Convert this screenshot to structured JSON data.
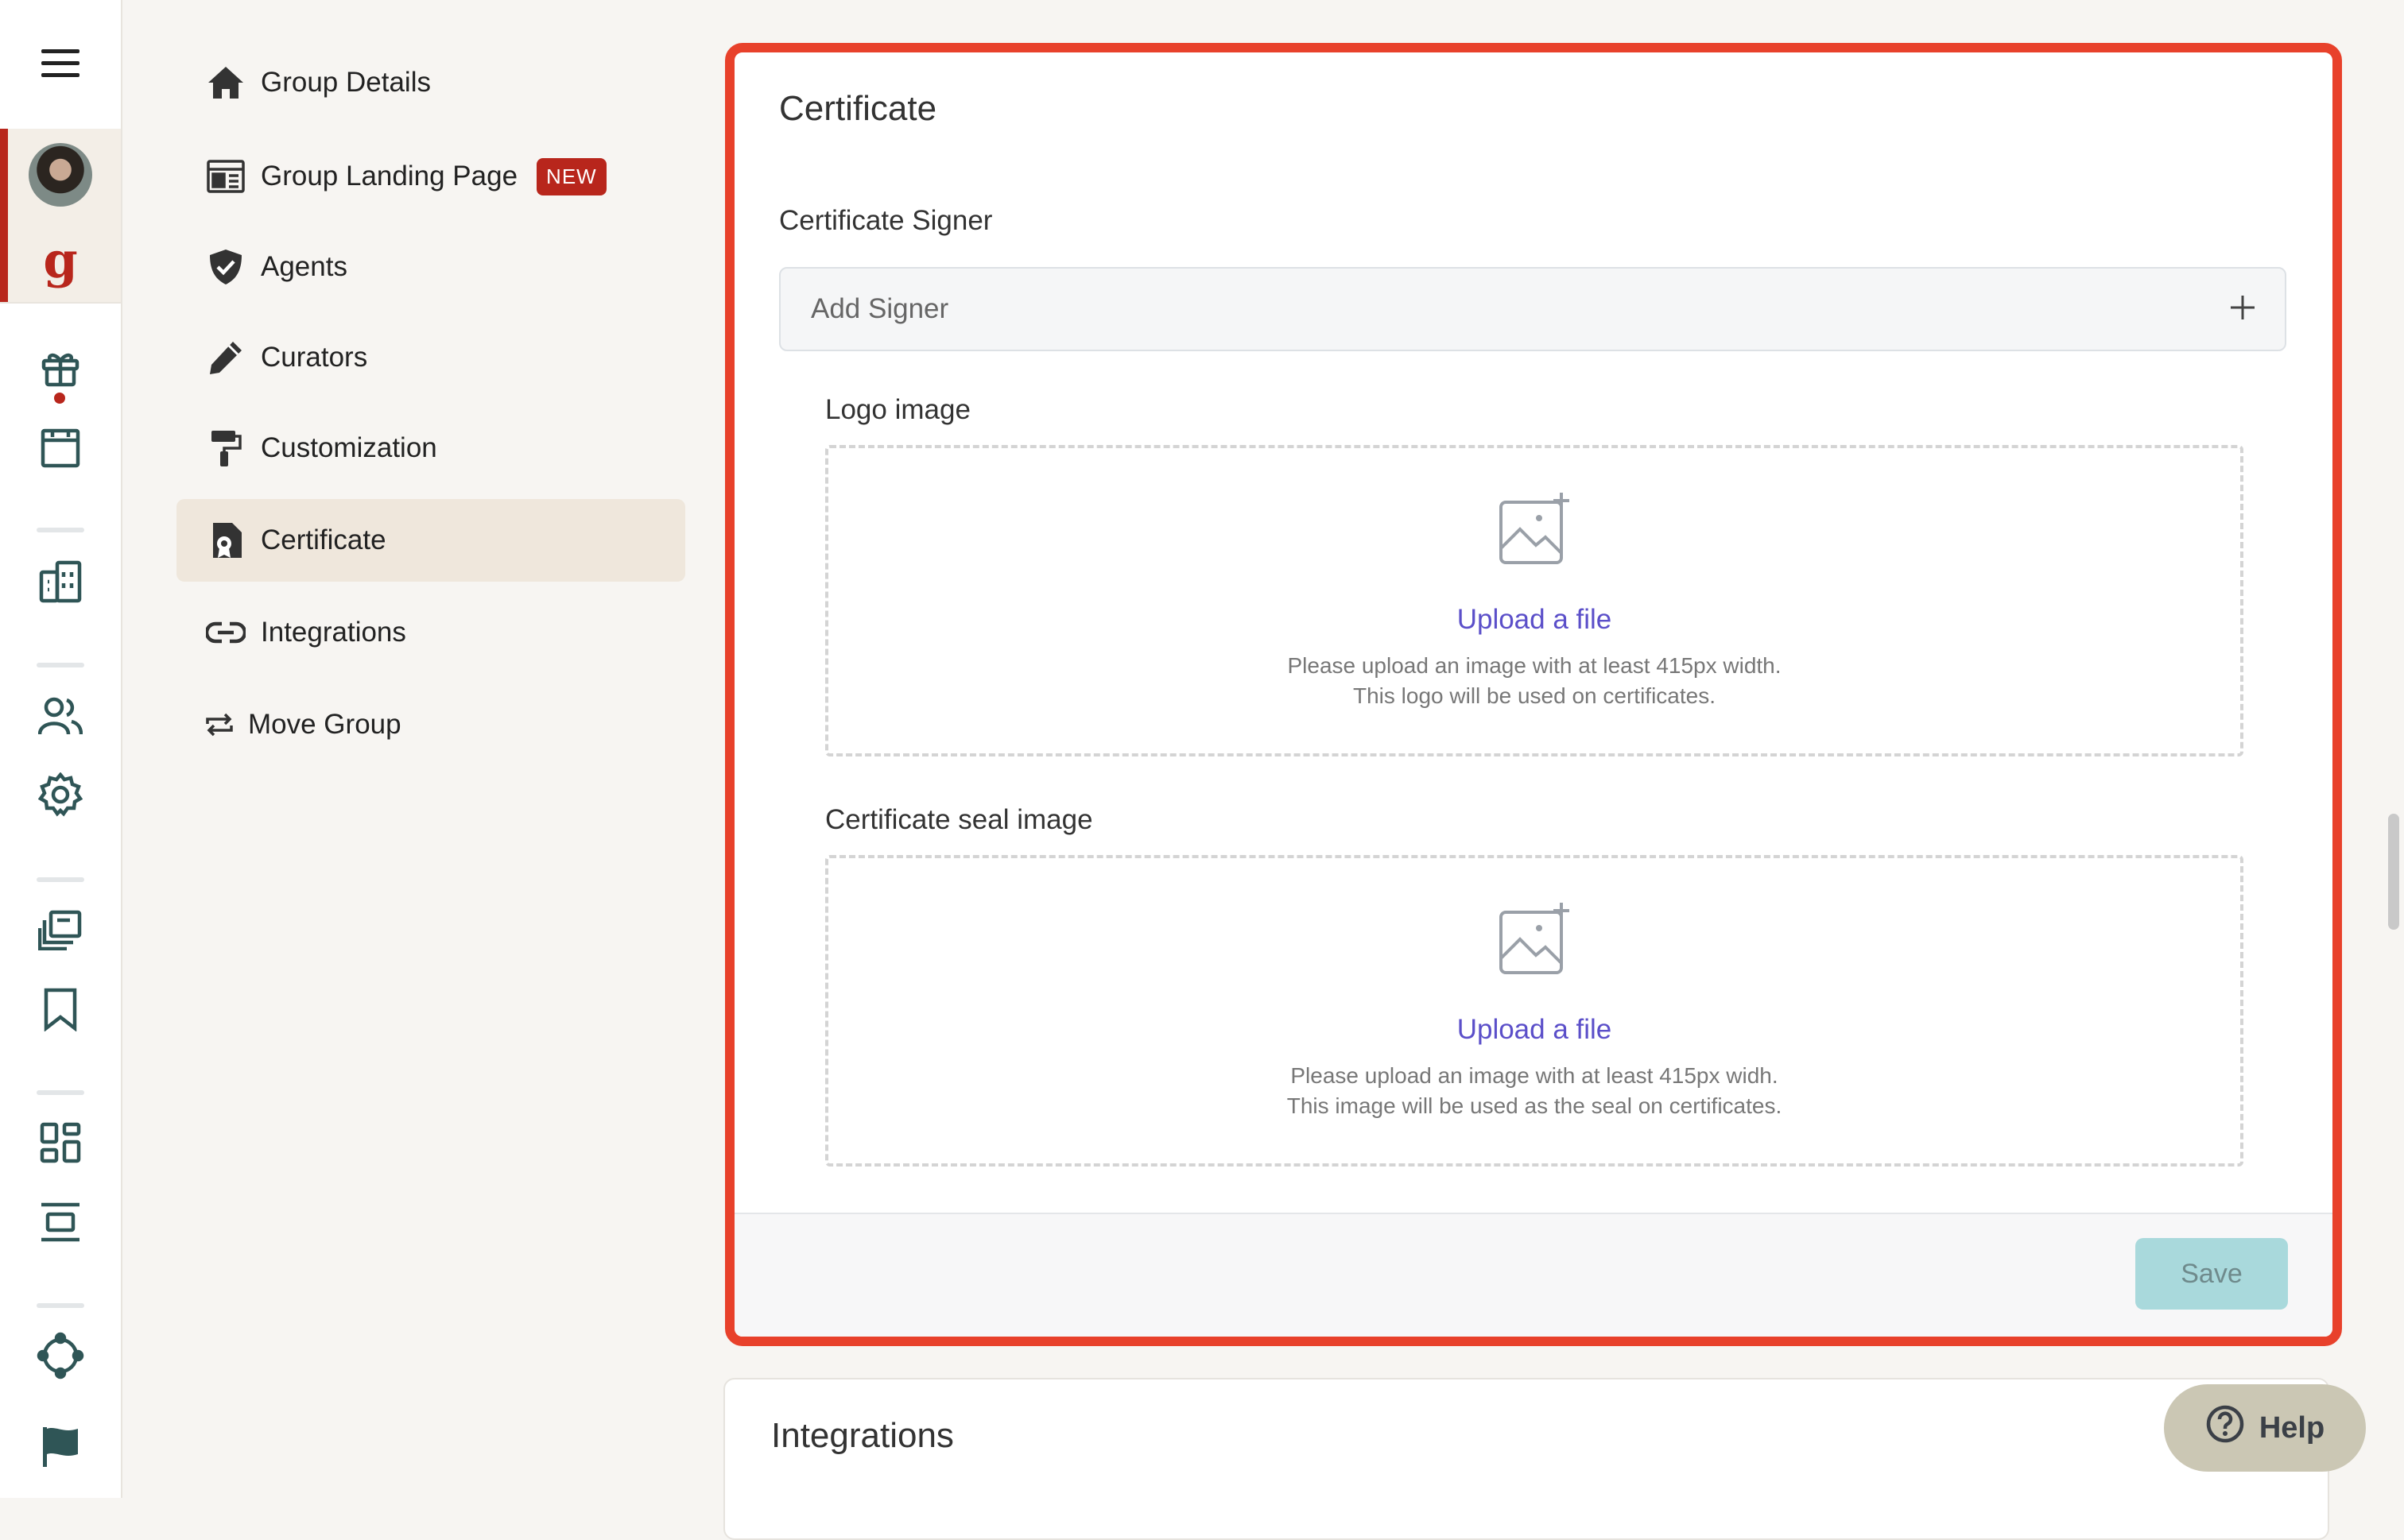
{
  "settings_nav": {
    "items": [
      {
        "label": "Group Details",
        "icon": "home-icon"
      },
      {
        "label": "Group Landing Page",
        "icon": "landing-page-icon",
        "badge": "NEW"
      },
      {
        "label": "Agents",
        "icon": "shield-check-icon"
      },
      {
        "label": "Curators",
        "icon": "pencil-icon"
      },
      {
        "label": "Customization",
        "icon": "paint-roller-icon"
      },
      {
        "label": "Certificate",
        "icon": "certificate-icon",
        "active": true
      },
      {
        "label": "Integrations",
        "icon": "link-icon"
      },
      {
        "label": "Move Group",
        "icon": "swap-arrows-icon"
      }
    ]
  },
  "rail": {
    "logo_letter": "g",
    "accent_color": "#b8261c",
    "icons": [
      "menu-icon",
      "avatar",
      "group-logo",
      "gift-icon",
      "calendar-icon",
      "buildings-icon",
      "people-icon",
      "gear-icon",
      "library-icon",
      "bookmark-icon",
      "dashboard-icon",
      "align-icon",
      "network-icon",
      "flag-icon"
    ]
  },
  "certificate_card": {
    "title": "Certificate",
    "signer_label": "Certificate Signer",
    "signer_placeholder": "Add Signer",
    "logo": {
      "label": "Logo image",
      "upload_text": "Upload a file",
      "hint_line1": "Please upload an image with at least 415px width.",
      "hint_line2": "This logo will be used on certificates."
    },
    "seal": {
      "label": "Certificate seal image",
      "upload_text": "Upload a file",
      "hint_line1": "Please upload an image with at least 415px widh.",
      "hint_line2": "This image will be used as the seal on certificates."
    },
    "save_label": "Save",
    "highlight_color": "#e8412b"
  },
  "integrations_card": {
    "title": "Integrations"
  },
  "help": {
    "label": "Help"
  }
}
